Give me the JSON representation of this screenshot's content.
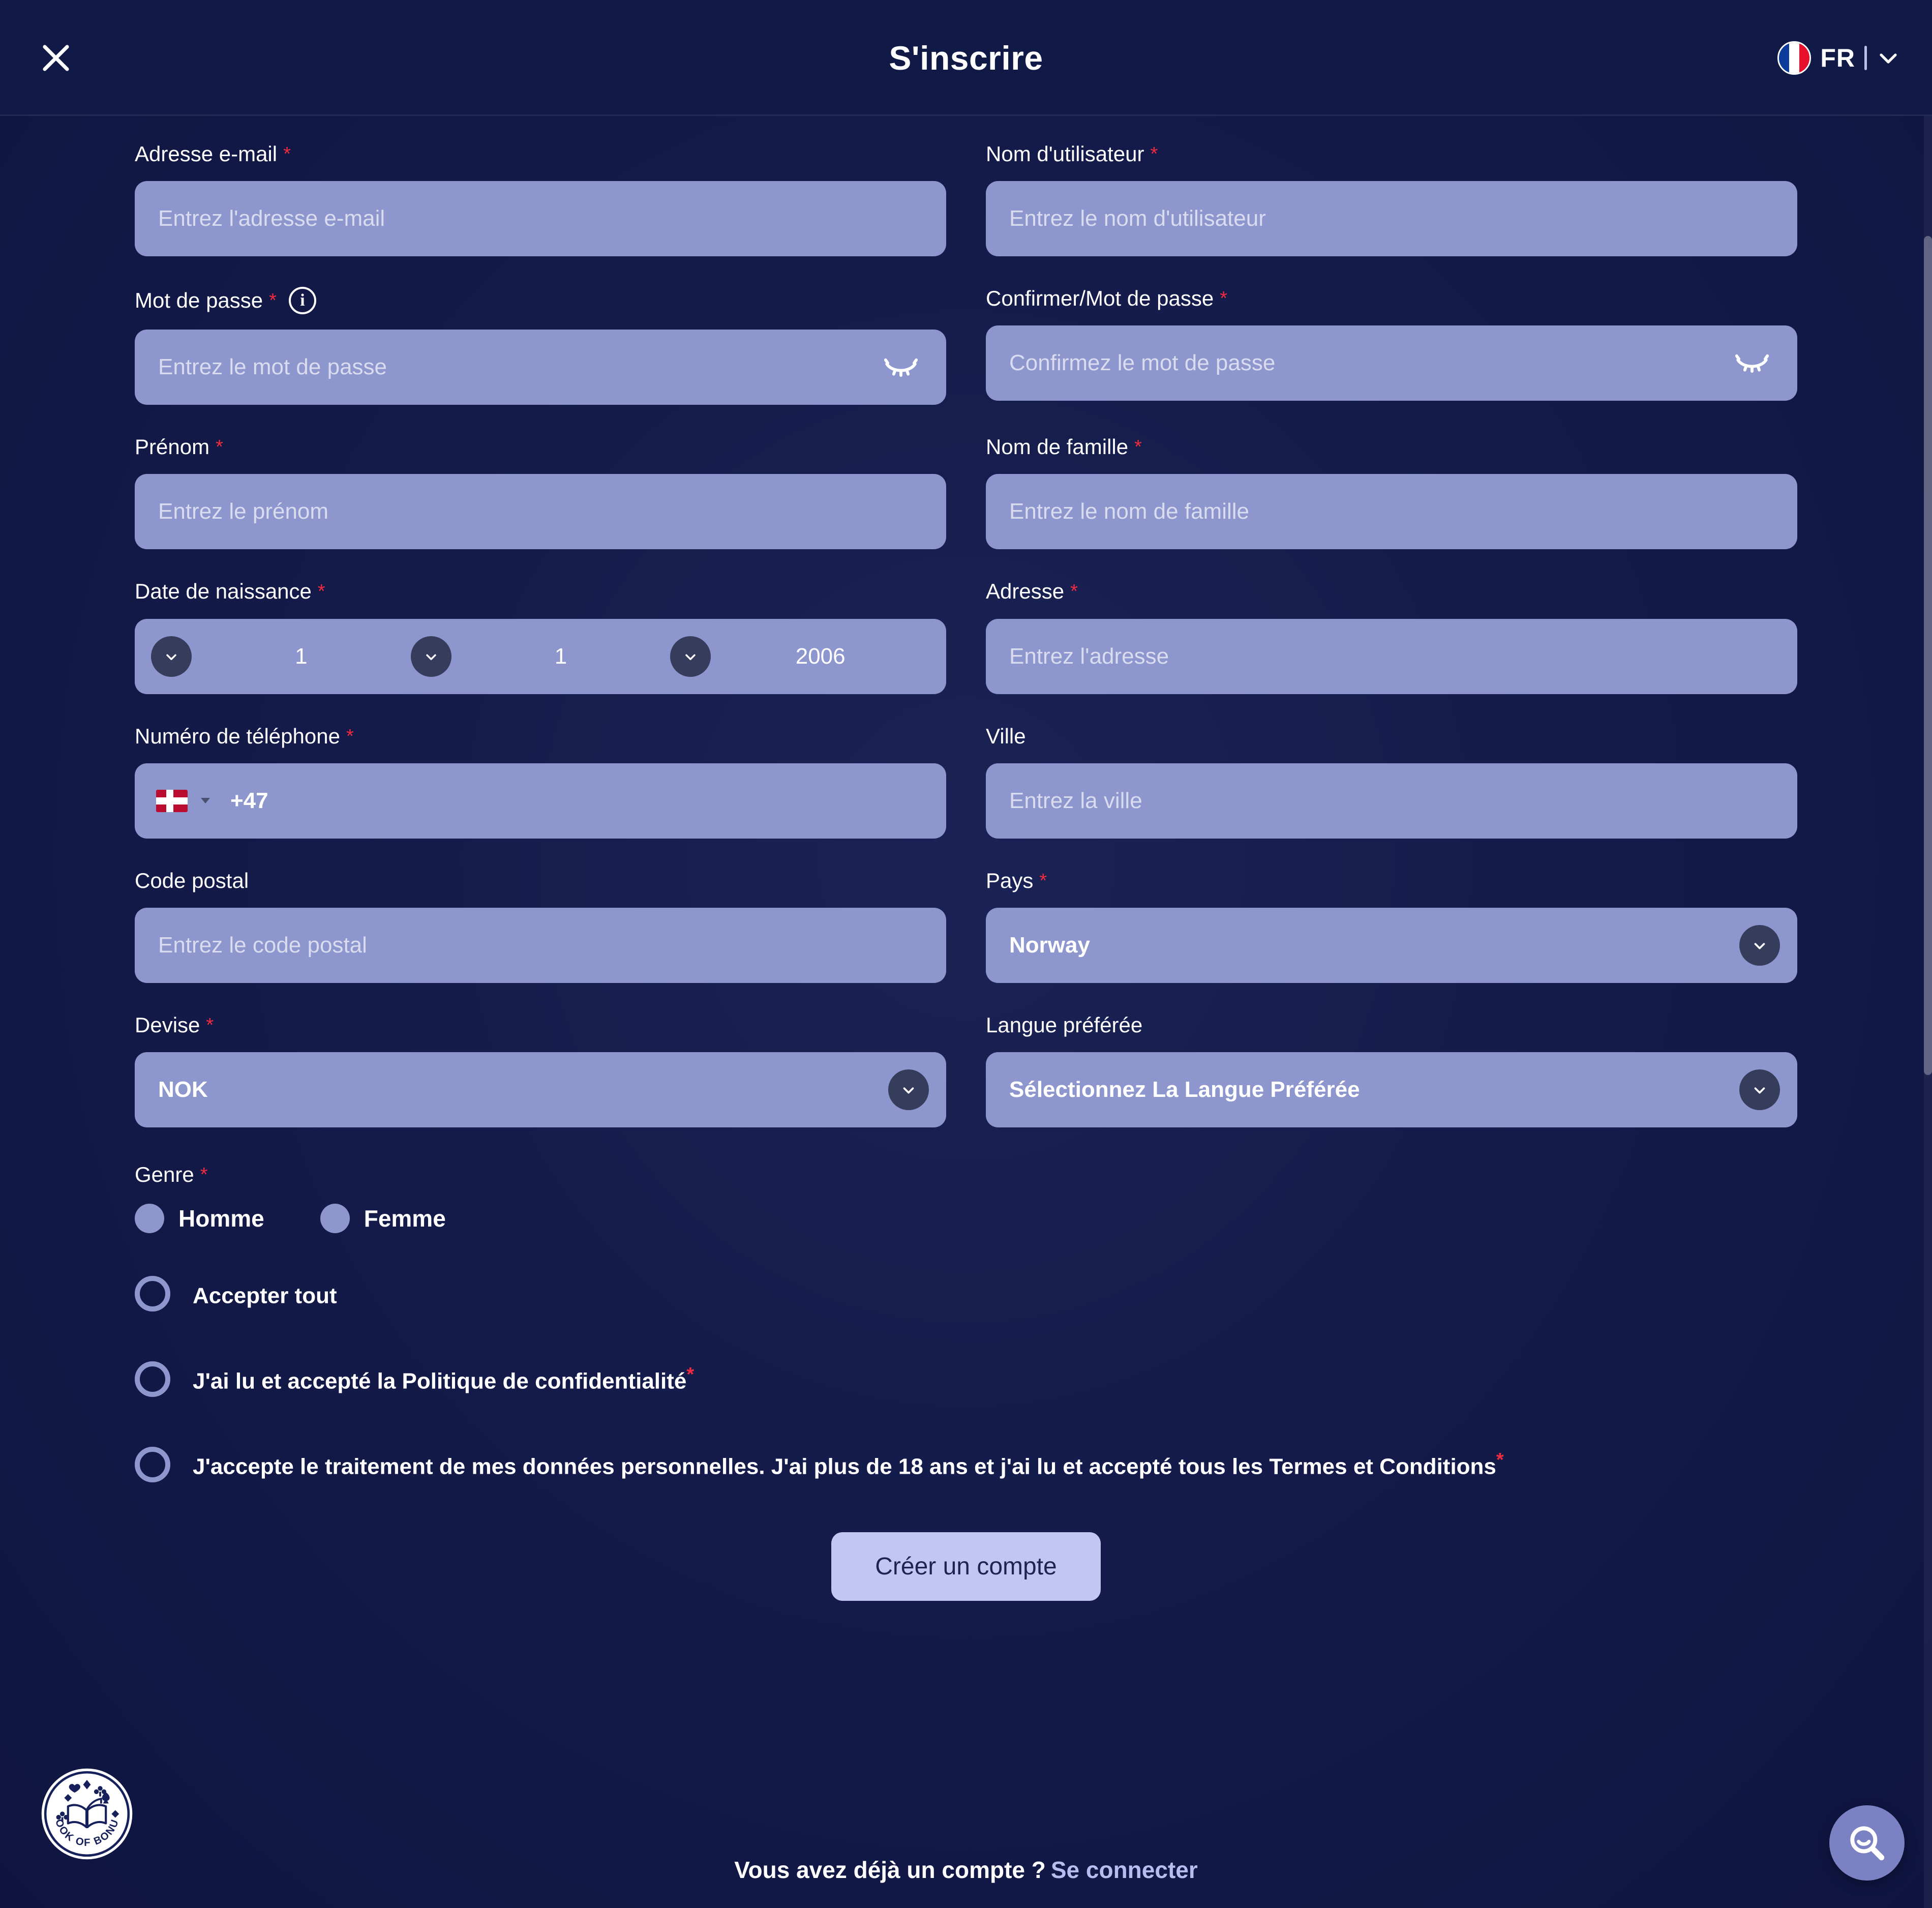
{
  "header": {
    "title": "S'inscrire",
    "close_icon": "close-icon",
    "language": {
      "code": "FR",
      "flag": "france-flag-icon",
      "chevron": "chevron-down-icon"
    }
  },
  "form": {
    "email": {
      "label": "Adresse e-mail",
      "required": "*",
      "placeholder": "Entrez l'adresse e-mail",
      "value": ""
    },
    "username": {
      "label": "Nom d'utilisateur",
      "required": "*",
      "placeholder": "Entrez le nom d'utilisateur",
      "value": ""
    },
    "password": {
      "label": "Mot de passe",
      "required": "*",
      "info_icon": "info-icon",
      "info_glyph": "i",
      "placeholder": "Entrez le mot de passe",
      "value": "",
      "toggle_icon": "eye-off-icon"
    },
    "confirm_password": {
      "label": "Confirmer/Mot de passe",
      "required": "*",
      "placeholder": "Confirmez le mot de passe",
      "value": "",
      "toggle_icon": "eye-off-icon"
    },
    "first_name": {
      "label": "Prénom",
      "required": "*",
      "placeholder": "Entrez le prénom",
      "value": ""
    },
    "last_name": {
      "label": "Nom de famille",
      "required": "*",
      "placeholder": "Entrez le nom de famille",
      "value": ""
    },
    "birth_date": {
      "label": "Date de naissance",
      "required": "*",
      "day": "1",
      "month": "1",
      "year": "2006"
    },
    "address": {
      "label": "Adresse",
      "required": "*",
      "placeholder": "Entrez l'adresse",
      "value": ""
    },
    "phone": {
      "label": "Numéro de téléphone",
      "required": "*",
      "flag": "norway-flag-icon",
      "dial_code": "+47",
      "value": ""
    },
    "city": {
      "label": "Ville",
      "required": "",
      "placeholder": "Entrez la ville",
      "value": ""
    },
    "postal_code": {
      "label": "Code postal",
      "required": "",
      "placeholder": "Entrez le code postal",
      "value": ""
    },
    "country": {
      "label": "Pays",
      "required": "*",
      "selected": "Norway"
    },
    "currency": {
      "label": "Devise",
      "required": "*",
      "selected": "NOK"
    },
    "language_pref": {
      "label": "Langue préférée",
      "required": "",
      "selected": "Sélectionnez La Langue Préférée"
    },
    "gender": {
      "label": "Genre",
      "required": "*",
      "options": [
        {
          "label": "Homme",
          "selected": false
        },
        {
          "label": "Femme",
          "selected": false
        }
      ]
    },
    "consents": [
      {
        "text": "Accepter tout",
        "required": "",
        "checked": false
      },
      {
        "text": "J'ai lu et accepté la Politique de confidentialité",
        "required": "*",
        "checked": false
      },
      {
        "text": "J'accepte le traitement de mes données personnelles. J'ai plus de 18 ans et j'ai lu et accepté tous les Termes et Conditions",
        "required": "*",
        "checked": false
      }
    ],
    "submit_label": "Créer un compte"
  },
  "footer": {
    "prompt": "Vous avez déjà un compte ?",
    "login_label": "Se connecter"
  },
  "brand": {
    "badge_name": "BOOK OF BONUS"
  },
  "search_fab": {
    "icon": "search-icon"
  },
  "colors": {
    "background": "#141b4a",
    "field": "#8e96ce",
    "accent": "#c3c6f0",
    "required": "#ef2b3d",
    "chevron_circle": "#353c5c"
  }
}
